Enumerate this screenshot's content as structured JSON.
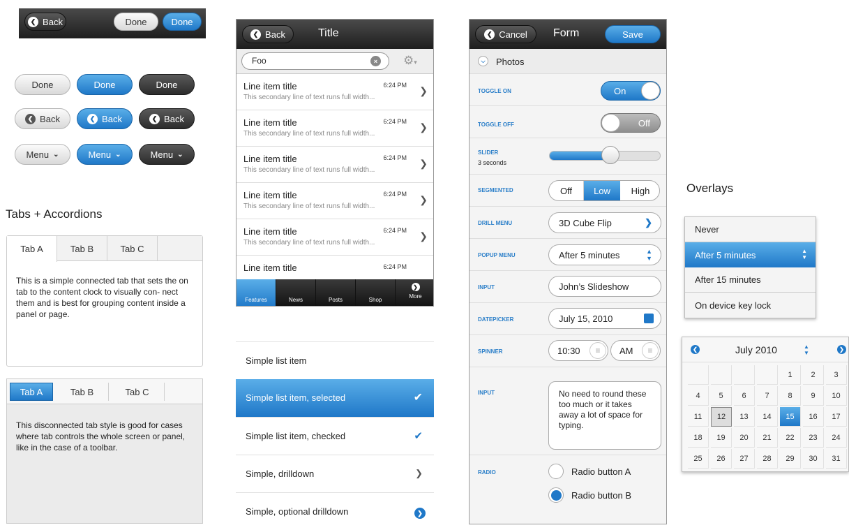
{
  "topbar": {
    "back": "Back",
    "done_light": "Done",
    "done_blue": "Done"
  },
  "buttons": {
    "done": [
      "Done",
      "Done",
      "Done"
    ],
    "back": [
      "Back",
      "Back",
      "Back"
    ],
    "menu": [
      "Menu",
      "Menu",
      "Menu"
    ]
  },
  "tabs_section": {
    "title": "Tabs + Accordions",
    "connected": {
      "tabs": [
        "Tab A",
        "Tab B",
        "Tab C"
      ],
      "body": "This is a simple connected tab that sets the on tab to the content clock to visually con- nect them and is best for grouping content inside a panel or page."
    },
    "disconnected": {
      "tabs": [
        "Tab A",
        "Tab B",
        "Tab C"
      ],
      "body": "This disconnected tab style is good for cases where tab controls the whole screen or panel, like in the case of a toolbar."
    }
  },
  "list_phone": {
    "back": "Back",
    "title": "Title",
    "search_value": "Foo",
    "items": [
      {
        "title": "Line item title",
        "time": "6:24 PM",
        "sub": "This secondary line of text runs full width..."
      },
      {
        "title": "Line item title",
        "time": "6:24 PM",
        "sub": "This secondary line of text runs full width..."
      },
      {
        "title": "Line item title",
        "time": "6:24 PM",
        "sub": "This secondary line of text runs full width..."
      },
      {
        "title": "Line item title",
        "time": "6:24 PM",
        "sub": "This secondary line of text runs full width..."
      },
      {
        "title": "Line item title",
        "time": "6:24 PM",
        "sub": "This secondary line of text runs full width..."
      },
      {
        "title": "Line item title",
        "time": "6:24 PM",
        "sub": ""
      }
    ],
    "bottom_nav": [
      "Features",
      "News",
      "Posts",
      "Shop",
      "More"
    ]
  },
  "simple_list": [
    {
      "label": "Simple list item"
    },
    {
      "label": "Simple list item, selected"
    },
    {
      "label": "Simple list item, checked"
    },
    {
      "label": "Simple, drilldown"
    },
    {
      "label": "Simple, optional drilldown"
    }
  ],
  "form": {
    "cancel": "Cancel",
    "title": "Form",
    "save": "Save",
    "photos": "Photos",
    "toggle_on_label": "TOGGLE ON",
    "toggle_on_value": "On",
    "toggle_off_label": "TOGGLE OFF",
    "toggle_off_value": "Off",
    "slider_label": "SLIDER",
    "slider_sub": "3 seconds",
    "slider_fraction": 0.55,
    "segmented_label": "SEGMENTED",
    "segments": [
      "Off",
      "Low",
      "High"
    ],
    "drill_label": "DRILL MENU",
    "drill_value": "3D Cube Flip",
    "popup_label": "POPUP MENU",
    "popup_value": "After 5 minutes",
    "input_label": "INPUT",
    "input_value": "John’s Slideshow",
    "date_label": "DATEPICKER",
    "date_value": "July 15, 2010",
    "spinner_label": "SPINNER",
    "spinner_time": "10:30",
    "spinner_ampm": "AM",
    "textarea_label": "INPUT",
    "textarea_value": "No need to round these too much or it takes away a lot of space for typing.",
    "radio_label": "RADIO",
    "radio_a": "Radio button A",
    "radio_b": "Radio button B"
  },
  "overlays": {
    "title": "Overlays",
    "menu": [
      "Never",
      "After 5 minutes",
      "After 15 minutes",
      "On device key lock"
    ],
    "calendar": {
      "month": "July 2010",
      "weeks": [
        [
          "",
          "",
          "",
          "",
          "1",
          "2",
          "3"
        ],
        [
          "4",
          "5",
          "6",
          "7",
          "8",
          "9",
          "10"
        ],
        [
          "11",
          "12",
          "13",
          "14",
          "15",
          "16",
          "17"
        ],
        [
          "18",
          "19",
          "20",
          "21",
          "22",
          "23",
          "24"
        ],
        [
          "25",
          "26",
          "27",
          "28",
          "29",
          "30",
          "31"
        ]
      ]
    }
  },
  "colors": {
    "accent": "#1f78c8",
    "dark": "#2a2a2a"
  }
}
